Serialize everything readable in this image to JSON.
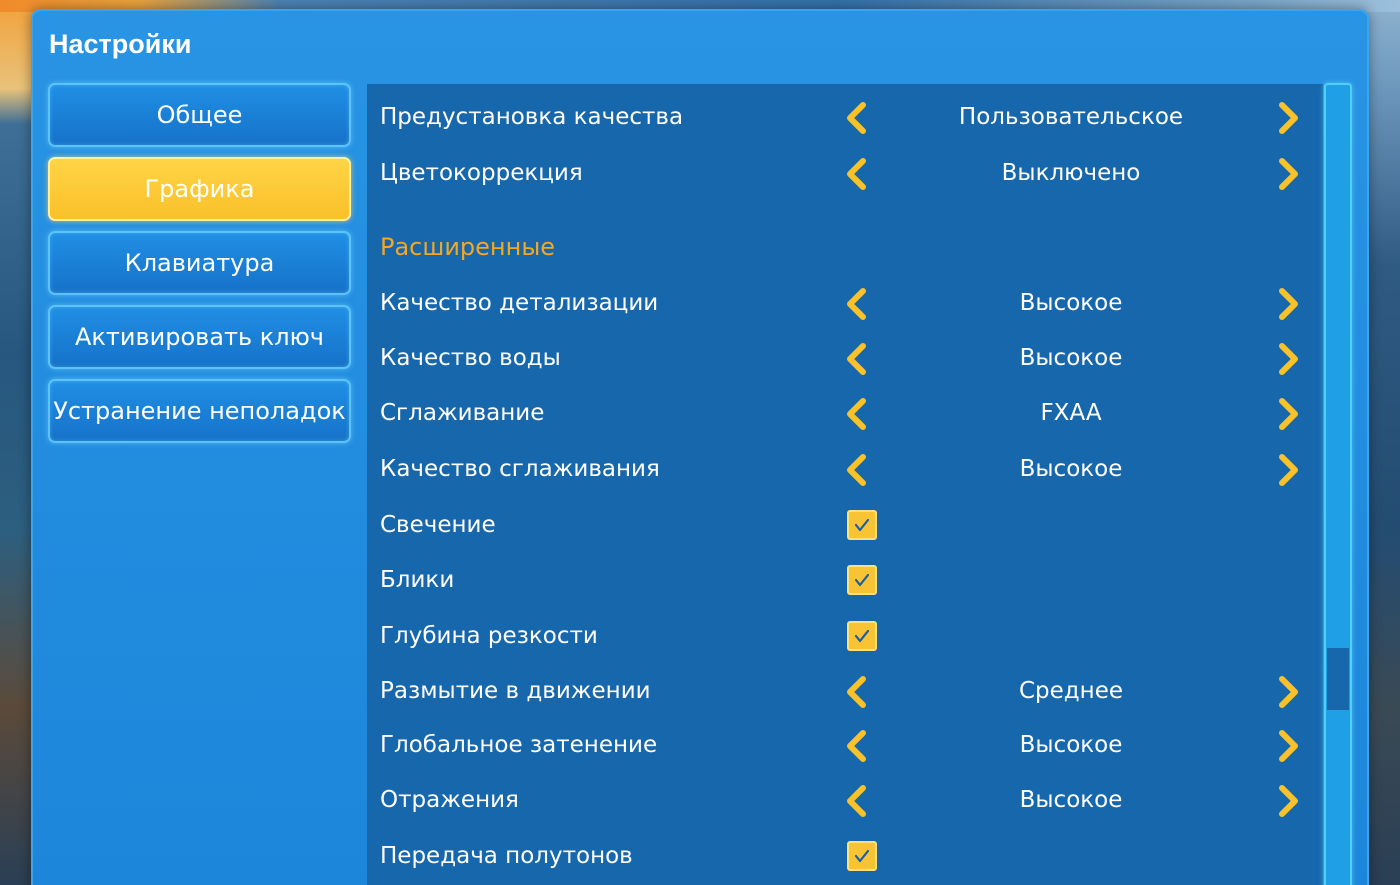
{
  "title": "Настройки",
  "nav": {
    "items": [
      {
        "label": "Общее",
        "active": false
      },
      {
        "label": "Графика",
        "active": true
      },
      {
        "label": "Клавиатура",
        "active": false
      },
      {
        "label": "Активировать ключ",
        "active": false
      },
      {
        "label": "Устранение неполадок",
        "active": false
      }
    ]
  },
  "settings": {
    "quality_preset": {
      "label": "Предустановка качества",
      "value": "Пользовательское"
    },
    "color_correction": {
      "label": "Цветокоррекция",
      "value": "Выключено"
    },
    "advanced_section": "Расширенные",
    "detail_quality": {
      "label": "Качество детализации",
      "value": "Высокое"
    },
    "water_quality": {
      "label": "Качество воды",
      "value": "Высокое"
    },
    "antialiasing": {
      "label": "Сглаживание",
      "value": "FXAA"
    },
    "antialiasing_quality": {
      "label": "Качество сглаживания",
      "value": "Высокое"
    },
    "bloom": {
      "label": "Свечение",
      "checked": true
    },
    "lens_flares": {
      "label": "Блики",
      "checked": true
    },
    "depth_of_field": {
      "label": "Глубина резкости",
      "checked": true
    },
    "motion_blur": {
      "label": "Размытие в движении",
      "value": "Среднее"
    },
    "ambient_occlusion": {
      "label": "Глобальное затенение",
      "value": "Высокое"
    },
    "reflections": {
      "label": "Отражения",
      "value": "Высокое"
    },
    "tonemapping": {
      "label": "Передача полутонов",
      "checked": true
    }
  },
  "colors": {
    "accent": "#f9c12a",
    "panel": "#1767ac",
    "window": "#1c86da",
    "section_header": "#f5a623"
  }
}
